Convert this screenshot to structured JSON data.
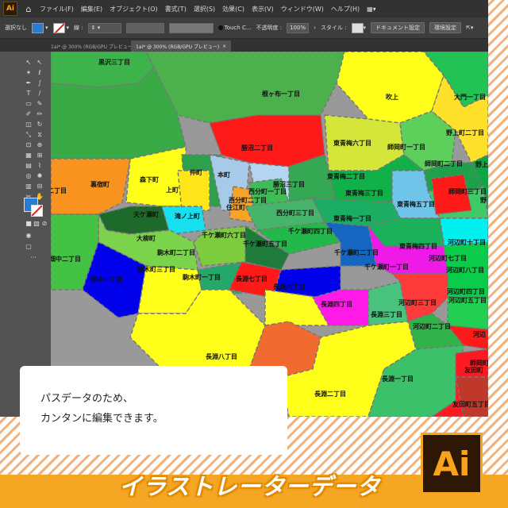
{
  "menu": [
    "ファイル(F)",
    "編集(E)",
    "オブジェクト(O)",
    "書式(T)",
    "選択(S)",
    "効果(C)",
    "表示(V)",
    "ウィンドウ(W)",
    "ヘルプ(H)"
  ],
  "app_logo": "Ai",
  "workspace_icon": "▦▾",
  "control": {
    "selection": "選択なし",
    "stroke_label": "線 :",
    "brush_name": "Touch C...",
    "opacity_label": "不透明度 :",
    "opacity_value": "100%",
    "style_label": "スタイル :",
    "doc_settings": "ドキュメント設定",
    "prefs": "環境設定"
  },
  "tabs": [
    "1ai* @ 300% (RGB/GPU プレビュー)",
    "1ai* @ 300% (RGB/GPU プレビュー)"
  ],
  "colors": {
    "fill": "#2a7bd4",
    "brand": "#f5a623",
    "ai_bg": "#2e1705",
    "ai_text": "#f7a41c"
  },
  "map_labels": [
    "黒沢三丁目",
    "根ヶ布一丁目",
    "吹上",
    "大門一丁目",
    "東青梅六丁目",
    "勝沼二丁目",
    "師岡町一丁目",
    "野上町二丁目",
    "野上",
    "東青梅二丁目",
    "師岡町二丁目",
    "裏宿町",
    "森下町",
    "仲町",
    "本町",
    "勝沼三丁目",
    "東青梅三丁目",
    "西分町一丁目",
    "西分町二丁目",
    "住江町",
    "上町",
    "天ケ瀬町",
    "滝ノ上町",
    "西分町三丁目",
    "東青梅一丁目",
    "東青梅四丁目",
    "大柳町",
    "千ケ瀬町六丁目",
    "千ケ瀬町四丁目",
    "千ケ瀬町五丁目",
    "千ケ瀬町二丁目",
    "千ケ瀬町一丁目",
    "河辺町十丁目",
    "河辺町八丁目",
    "畑中二丁目",
    "畑中一丁目",
    "駒木町三丁目",
    "駒木町一丁目",
    "長淵七丁目",
    "長淵六丁目",
    "長淵四丁目",
    "長淵三丁目",
    "河辺町四丁目",
    "河辺町三丁目",
    "河辺町二丁目",
    "河辺",
    "長淵八丁目",
    "長淵二丁目",
    "長淵一丁目",
    "友田町",
    "友田町五丁目",
    "東青梅五丁目",
    "河辺町七丁目",
    "河辺町五丁目",
    "師岡町三丁目",
    "師岡町",
    "駒木町二丁目",
    "野",
    "二丁目"
  ],
  "promo": {
    "line1": "パスデータのため、",
    "line2": "カンタンに編集できます。",
    "title": "イラストレーターデータ",
    "logo": "Ai"
  }
}
